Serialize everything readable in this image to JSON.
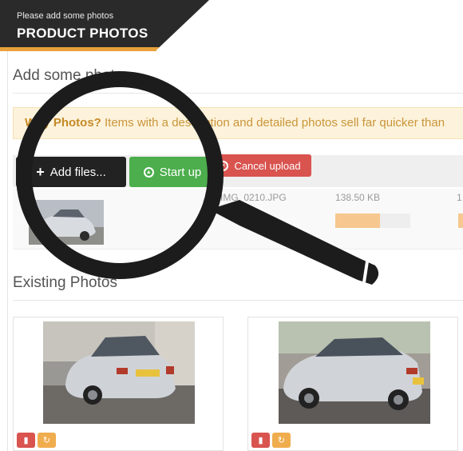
{
  "header": {
    "subtitle": "Please add some photos",
    "title": "PRODUCT PHOTOS"
  },
  "add_section": {
    "title": "Add some photos"
  },
  "notice": {
    "strong": "Why Photos?",
    "text": " Items with a description and detailed photos sell far quicker than"
  },
  "toolbar": {
    "add_files_label": "Add files...",
    "start_upload_label": "Start up",
    "cancel_upload_label": "Cancel upload"
  },
  "upload": {
    "file_name": "IMG_0210.JPG",
    "file_size": "138.50 KB",
    "progress_percent": 60,
    "truncated_value": "1"
  },
  "existing_section": {
    "title": "Existing Photos"
  },
  "icons": {
    "plus": "plus-icon",
    "upload": "upload-circle-icon",
    "cancel": "cancel-circle-icon",
    "delete": "trash-icon",
    "rotate": "refresh-icon",
    "magnifier": "magnifying-glass-icon"
  },
  "colors": {
    "accent": "#e8a13a",
    "header_bg": "#2a2a2a",
    "add_button": "#222222",
    "start_button": "#4cae4c",
    "cancel_button": "#d9534f",
    "rotate_button": "#f0ad4e",
    "notice_bg": "#fdf3dc",
    "notice_text": "#c58a27"
  }
}
